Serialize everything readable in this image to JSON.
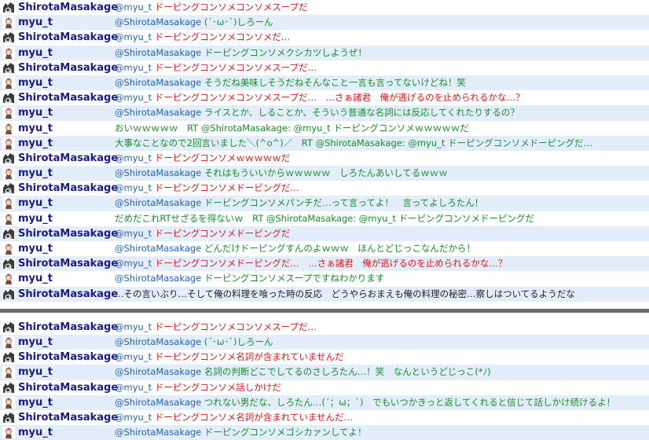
{
  "colors": {
    "username": "#1a1a8c",
    "mention": "#1f63b8",
    "shirota_text": "#e0181a",
    "myu_text": "#15902a",
    "neutral_text": "#222222",
    "row_alt_bg": "#e4eefa",
    "divider": "#6a6a6a"
  },
  "icons": {
    "shirota": "shirota-avatar-icon",
    "myu": "myu-avatar-icon"
  },
  "block1": [
    {
      "user": "ShirotaMasakage",
      "mention": "@myu_t",
      "text": " ドーピングコンソメコンソメスープだ"
    },
    {
      "user": "myu_t",
      "mention": "@ShirotaMasakage",
      "text": " (´･ω･`)しろーん"
    },
    {
      "user": "ShirotaMasakage",
      "mention": "@myu_t",
      "text": " ドーピングコンソメコンソメだ…"
    },
    {
      "user": "myu_t",
      "mention": "@ShirotaMasakage",
      "text": " ドーピングコンソメクシカツしようぜ！"
    },
    {
      "user": "ShirotaMasakage",
      "mention": "@myu_t",
      "text": " ドーピングコンソメコンソメスープだ…"
    },
    {
      "user": "myu_t",
      "mention": "@ShirotaMasakage",
      "text": " そうだね美味しそうだねそんなこと一言も言ってないけどね！笑"
    },
    {
      "user": "ShirotaMasakage",
      "mention": "@myu_t",
      "text": " ドーピングコンソメコンソメスープだ…　…さぁ諸君　俺が逃げるのを止められるかな…？"
    },
    {
      "user": "myu_t",
      "mention": "@ShirotaMasakage",
      "text": " ライスとか、しることか、そういう普通な名詞には反応してくれたりするの？"
    },
    {
      "user": "myu_t",
      "mention": "",
      "text": "おいｗｗｗｗｗ　RT @ShirotaMasakage: @myu_t ドーピングコンソメｗｗｗｗｗだ"
    },
    {
      "user": "myu_t",
      "mention": "",
      "text": "大事なことなので2回言いました＼(^o^)／　RT @ShirotaMasakage: @myu_t ドーピングコンソメドーピングだ…"
    },
    {
      "user": "ShirotaMasakage",
      "mention": "@myu_t",
      "text": " ドーピングコンソメｗｗｗｗｗだ"
    },
    {
      "user": "myu_t",
      "mention": "@ShirotaMasakage",
      "text": " それはもういいからｗｗｗｗｗ　しろたんあいしてるｗｗｗ"
    },
    {
      "user": "ShirotaMasakage",
      "mention": "@myu_t",
      "text": " ドーピングコンソメドーピングだ…"
    },
    {
      "user": "myu_t",
      "mention": "@ShirotaMasakage",
      "text": " ドーピングコンソメパンチだ…って言ってよ！　言ってよしろたん！"
    },
    {
      "user": "myu_t",
      "mention": "",
      "text": "だめだこれRTせざるを得ないｗ　RT @ShirotaMasakage: @myu_t ドーピングコンソメドーピングだ"
    },
    {
      "user": "ShirotaMasakage",
      "mention": "@myu_t",
      "text": " ドーピングコンソメドーピングだ"
    },
    {
      "user": "myu_t",
      "mention": "@ShirotaMasakage",
      "text": " どんだけドーピングすんのよｗｗｗ　ほんとどじっこなんだから！"
    },
    {
      "user": "ShirotaMasakage",
      "mention": "@myu_t",
      "text": " ドーピングコンソメドーピングだ…　…さぁ諸君　俺が逃げるのを止められるかな…？"
    },
    {
      "user": "myu_t",
      "mention": "@ShirotaMasakage",
      "text": " ドーピングコンソメスープですねわかります"
    },
    {
      "user": "ShirotaMasakage",
      "mention": "",
      "text": "…その言いぶり…そして俺の料理を喰った時の反応　どうやらおまえも俺の料理の秘密…察しはついてるようだな"
    }
  ],
  "block2": [
    {
      "user": "ShirotaMasakage",
      "mention": "@myu_t",
      "text": " ドーピングコンソメコンソメスープだ…"
    },
    {
      "user": "myu_t",
      "mention": "@ShirotaMasakage",
      "text": " (´･ω･`)しろーん"
    },
    {
      "user": "ShirotaMasakage",
      "mention": "@myu_t",
      "text": " ドーピングコンソメ名詞が含まれていませんだ"
    },
    {
      "user": "myu_t",
      "mention": "@ShirotaMasakage",
      "text": " 名詞の判断どこでしてるのさしろたん…！笑　なんというどじっこ(*ﾉ)"
    },
    {
      "user": "ShirotaMasakage",
      "mention": "@myu_t",
      "text": " ドーピングコンソメ話しかけだ"
    },
    {
      "user": "myu_t",
      "mention": "@ShirotaMasakage",
      "text": " つれない男だな、しろたん…(´；ω；`)　でもいつかきっと返してくれると信じて話しかけ続けるよ！"
    },
    {
      "user": "ShirotaMasakage",
      "mention": "@myu_t",
      "text": " ドーピングコンソメ名詞が含まれていませんだ…"
    },
    {
      "user": "myu_t",
      "mention": "@ShirotaMasakage",
      "text": " ドーピングコンソメゴシカァンしてよ！"
    }
  ]
}
